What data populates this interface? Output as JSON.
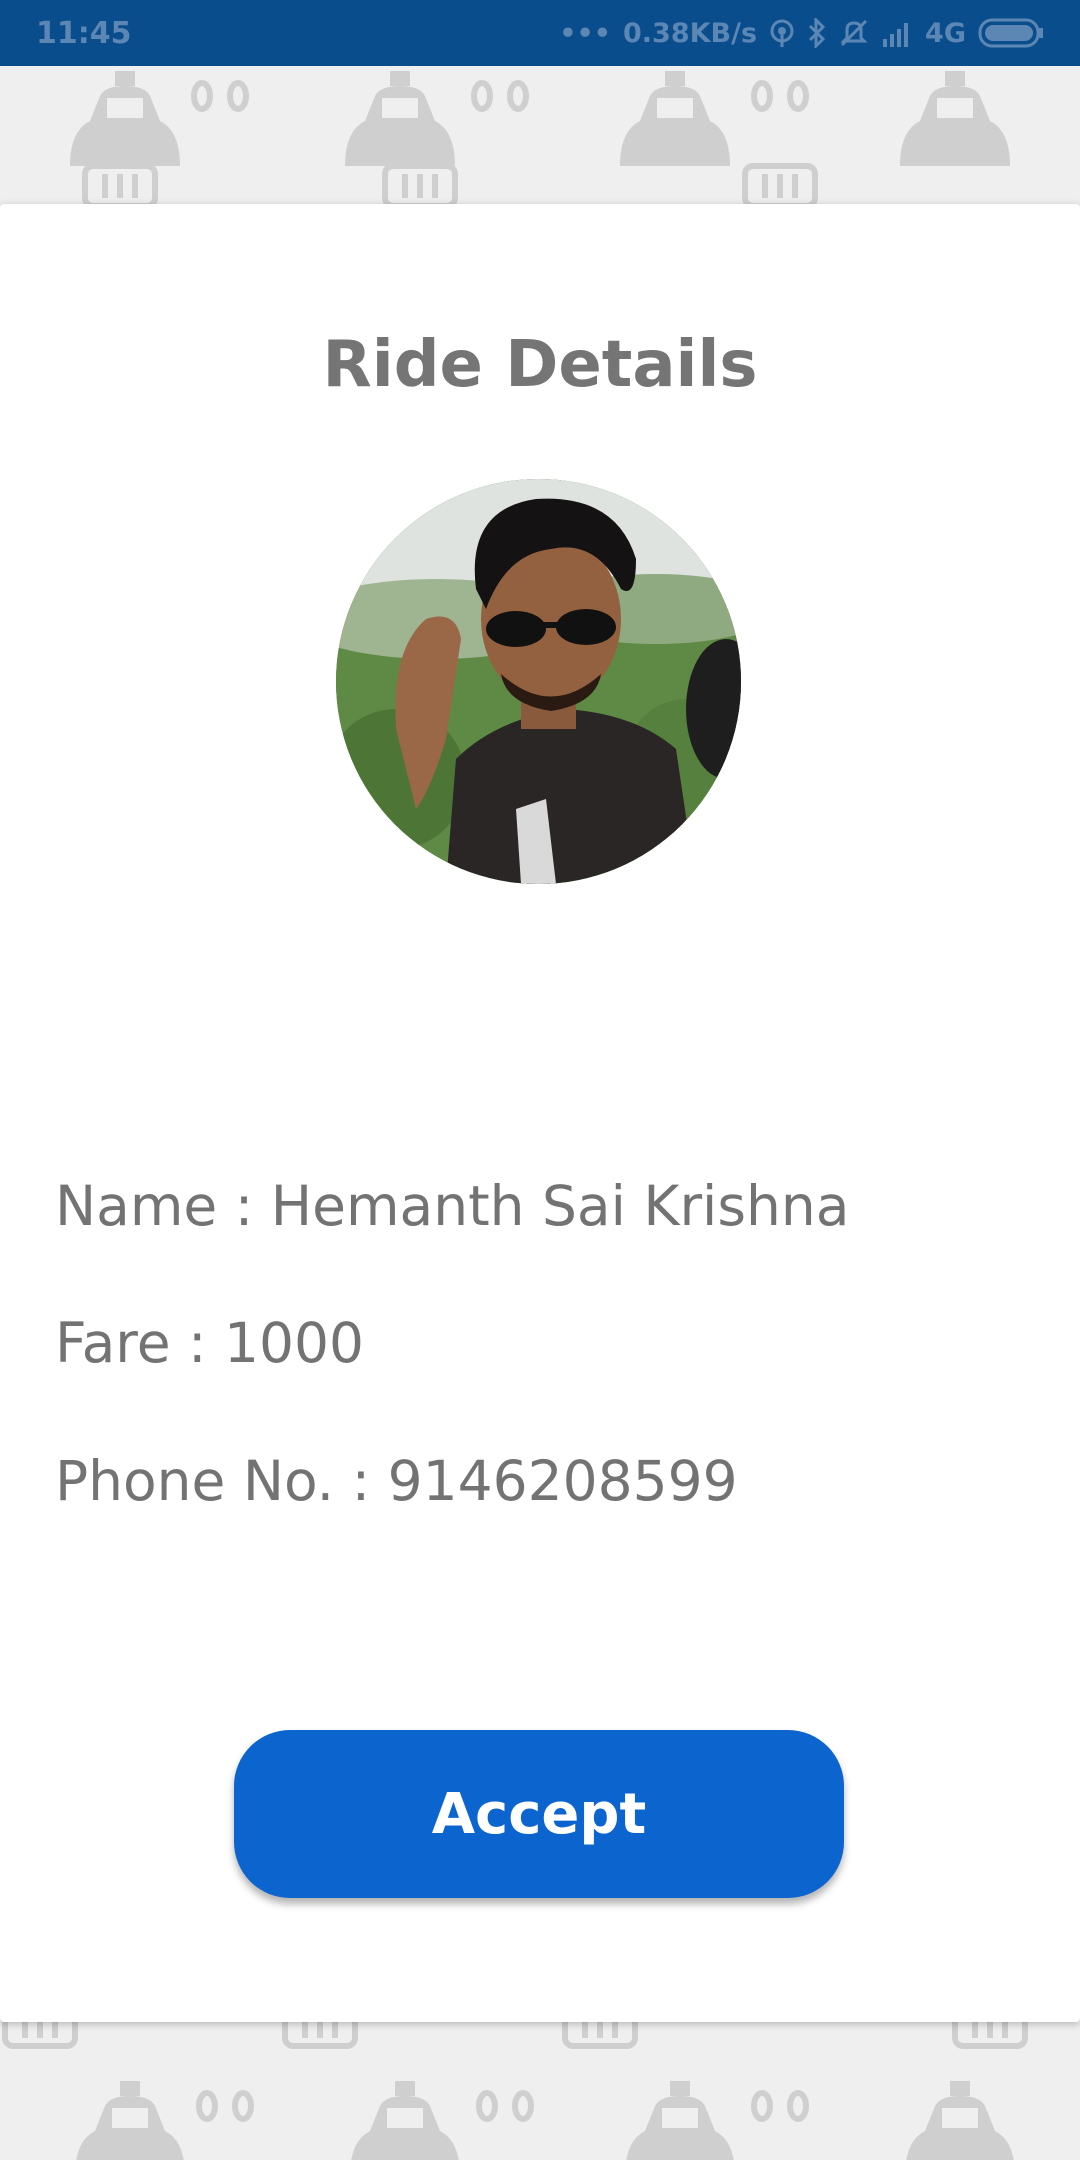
{
  "status_bar": {
    "time": "11:45",
    "network_speed": "0.38KB/s",
    "network_type": "4G",
    "icons": [
      "more-dots-icon",
      "hotspot-icon",
      "bluetooth-icon",
      "mute-icon",
      "signal-icon",
      "battery-icon"
    ]
  },
  "background": {
    "pattern_icon": "taxi-car-icon"
  },
  "card": {
    "title": "Ride Details",
    "avatar_alt": "rider-avatar",
    "name_line": "Name : Hemanth Sai Krishna",
    "fare_line": "Fare : 1000",
    "phone_line": "Phone No. : 9146208599",
    "accept_label": "Accept"
  },
  "colors": {
    "status_bar": "#0a4d8c",
    "accent": "#0c65cf",
    "text": "#737373",
    "card": "#ffffff"
  }
}
